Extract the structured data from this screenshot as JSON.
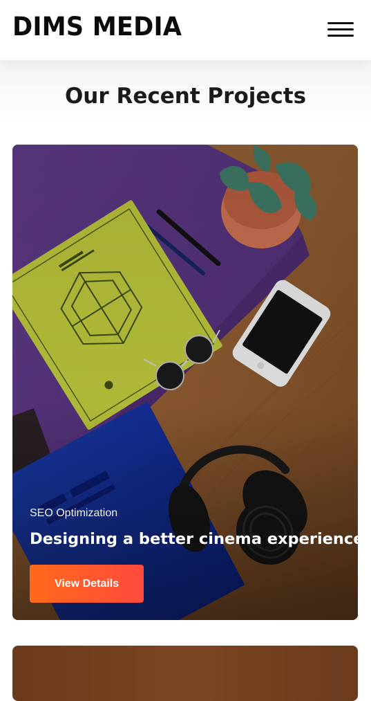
{
  "header": {
    "logo_text": "DIMS MEDIA"
  },
  "section": {
    "title": "Our Recent Projects"
  },
  "projects": [
    {
      "category": "SEO Optimization",
      "title": "Designing a better cinema experience",
      "button_label": "View Details"
    }
  ],
  "colors": {
    "button_gradient_start": "#ff6a1a",
    "button_gradient_end": "#ff4a3d",
    "text_dark": "#1a1a1a"
  },
  "icons": {
    "menu": "hamburger-menu-icon"
  }
}
